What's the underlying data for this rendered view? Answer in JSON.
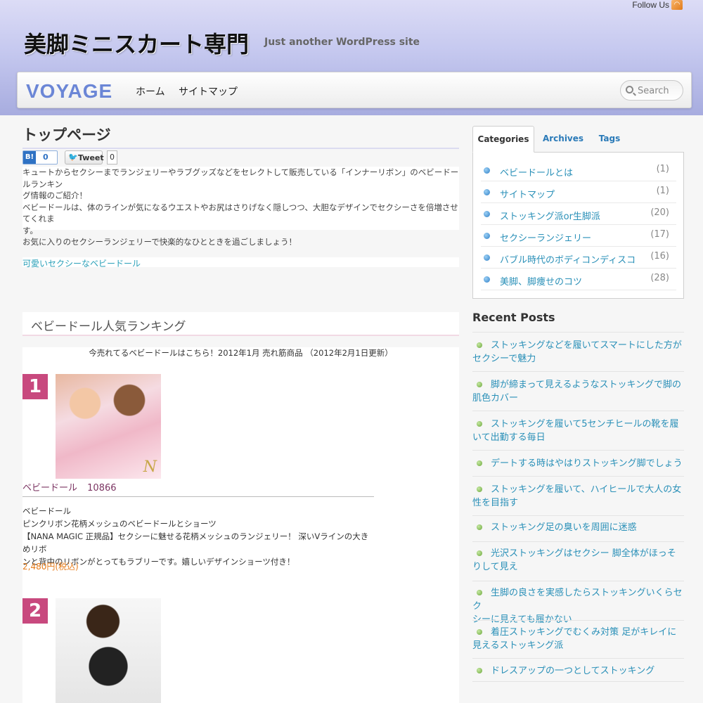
{
  "header": {
    "follow_label": "Follow Us",
    "site_title": "美脚ミニスカート専門",
    "site_description": "Just another WordPress site"
  },
  "nav": {
    "logo": "VOYAGE",
    "items": [
      {
        "label": "ホーム"
      },
      {
        "label": "サイトマップ"
      }
    ],
    "search_placeholder": "Search"
  },
  "main": {
    "page_title": "トップページ",
    "hatena": {
      "label": "B!",
      "count": "0"
    },
    "tweet": {
      "label": "Tweet",
      "count": "0"
    },
    "intro_lines": [
      "キュートからセクシーまでランジェリーやラブグッズなどをセレクトして販売している「インナーリボン」のベビードールランキン",
      "グ情報のご紹介！",
      "ベビードールは、体のラインが気になるウエストやお尻はさりげなく隠しつつ、大胆なデザインでセクシーさを倍増させてくれま",
      "す。",
      "お気に入りのセクシーランジェリーで快楽的なひとときを過ごしましょう！"
    ],
    "cute_link": "可愛いセクシーなベビードール",
    "section_title": "ベビードール人気ランキング",
    "ranking_subtitle": "今売れてるベビードールはこちら！2012年1月 売れ筋商品 （2012年2月1日更新）",
    "items": [
      {
        "rank": "1",
        "title": "ベビードール",
        "rate": "10866",
        "desc_lines": [
          "ベビードール",
          "ピンクリボン花柄メッシュのベビードールとショーツ",
          "【NANA MAGIC 正規品】セクシーに魅せる花柄メッシュのランジェリー！ 深いVラインの大きめリボ",
          "ンと背中のリボンがとってもラブリーです。嬉しいデザインショーツ付き！"
        ],
        "price": "2,480円(税込)",
        "logo_mark": "N"
      },
      {
        "rank": "2"
      }
    ]
  },
  "sidebar": {
    "tabs": [
      {
        "label": "Categories",
        "active": true
      },
      {
        "label": "Archives",
        "active": false
      },
      {
        "label": "Tags",
        "active": false
      }
    ],
    "categories": [
      {
        "name": "ベビードールとは",
        "count": "(1)"
      },
      {
        "name": "サイトマップ",
        "count": "(1)"
      },
      {
        "name": "ストッキング派or生脚派",
        "count": "(20)"
      },
      {
        "name": "セクシーランジェリー",
        "count": "(17)"
      },
      {
        "name": "バブル時代のボディコンディスコ",
        "count": "(16)"
      },
      {
        "name": "美脚、脚痩せのコツ",
        "count": "(28)"
      }
    ],
    "recent_title": "Recent Posts",
    "recent_posts": [
      {
        "line1": "ストッキングなどを履いてスマートにした方が",
        "line2": "セクシーで魅力"
      },
      {
        "line1": "脚が締まって見えるようなストッキングで脚の",
        "line2": "肌色カバー"
      },
      {
        "line1": "ストッキングを履いて5センチヒールの靴を履",
        "line2": "いて出勤する毎日"
      },
      {
        "line1": "デートする時はやはりストッキング脚でしょう",
        "line2": ""
      },
      {
        "line1": "ストッキングを履いて、ハイヒールで大人の女",
        "line2": "性を目指す"
      },
      {
        "line1": "ストッキング足の臭いを周囲に迷惑",
        "line2": ""
      },
      {
        "line1": "光沢ストッキングはセクシー 脚全体がほっそ",
        "line2": "りして見え"
      },
      {
        "line1": "生脚の良さを実感したらストッキングいくらセク",
        "line2": "シーに見えても履かない"
      },
      {
        "line1": "着圧ストッキングでむくみ対策 足がキレイに",
        "line2": "見えるストッキング派"
      },
      {
        "line1": "ドレスアップの一つとしてストッキング",
        "line2": ""
      }
    ]
  }
}
